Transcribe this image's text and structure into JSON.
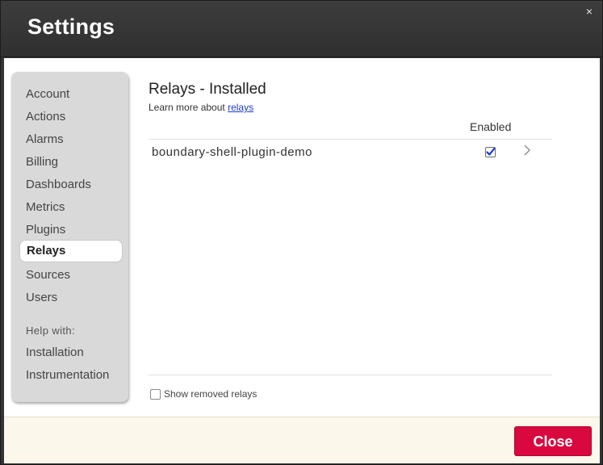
{
  "window": {
    "title": "Settings",
    "close_glyph": "×"
  },
  "sidebar": {
    "items": [
      {
        "label": "Account"
      },
      {
        "label": "Actions"
      },
      {
        "label": "Alarms"
      },
      {
        "label": "Billing"
      },
      {
        "label": "Dashboards"
      },
      {
        "label": "Metrics"
      },
      {
        "label": "Plugins"
      },
      {
        "label": "Relays",
        "active": true
      },
      {
        "label": "Sources"
      },
      {
        "label": "Users"
      }
    ],
    "help_label": "Help with:",
    "help_items": [
      {
        "label": "Installation"
      },
      {
        "label": "Instrumentation"
      }
    ]
  },
  "main": {
    "heading": "Relays - Installed",
    "learn_prefix": "Learn more about",
    "learn_link": "relays",
    "column_enabled": "Enabled",
    "relays": [
      {
        "name": "boundary-shell-plugin-demo",
        "enabled": true
      }
    ],
    "show_removed_label": "Show removed relays",
    "show_removed_checked": false
  },
  "footer": {
    "close_label": "Close"
  },
  "colors": {
    "accent": "#d9083f",
    "link": "#1a3ccf",
    "check": "#1a3ccf"
  }
}
